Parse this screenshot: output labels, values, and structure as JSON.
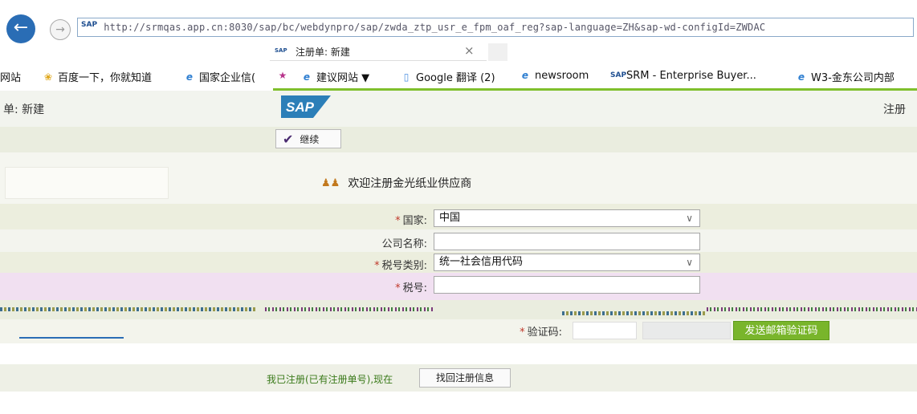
{
  "browser": {
    "url": "http://srmqas.app.cn:8030/sap/bc/webdynpro/sap/zwda_ztp_usr_e_fpm_oaf_reg?sap-language=ZH&sap-wd-configId=ZWDAC",
    "tab_title": "注册单: 新建",
    "tab_close": "×",
    "tab_icon_text": "SAP",
    "url_icon_text": "SAP"
  },
  "favorites": [
    {
      "label": "网站",
      "icon": ""
    },
    {
      "label": "百度一下，你就知道",
      "icon": "paw-icon"
    },
    {
      "label": "国家企业信(",
      "icon": "ie-icon"
    },
    {
      "label": "",
      "icon": "star-folder-icon"
    },
    {
      "label": "建议网站 ▼",
      "icon": "ie-icon"
    },
    {
      "label": "Google 翻译 (2)",
      "icon": "translate-icon"
    },
    {
      "label": "newsroom",
      "icon": "ie-icon"
    },
    {
      "label": "SRM - Enterprise Buyer...",
      "icon": "sap-icon"
    },
    {
      "label": "W3-金东公司内部",
      "icon": "ie-icon"
    }
  ],
  "header": {
    "title": "单: 新建",
    "logo_text": "SAP",
    "right_text": "注册"
  },
  "toolbar": {
    "continue_label": "继续"
  },
  "welcome": {
    "text": "欢迎注册金光纸业供应商"
  },
  "form": {
    "country_label": "国家:",
    "country_value": "中国",
    "company_label": "公司名称:",
    "company_value": "",
    "tax_type_label": "税号类别:",
    "tax_type_value": "统一社会信用代码",
    "tax_no_label": "税号:",
    "tax_no_value": "",
    "required_mark": "*",
    "captcha_label": "验证码:",
    "send_code_label": "发送邮箱验证码"
  },
  "retrieve": {
    "text": "我已注册(已有注册单号),现在",
    "button_label": "找回注册信息"
  },
  "colors": {
    "accent_green": "#7fbf2c",
    "sap_blue": "#1f4f91",
    "back_blue": "#2a6db5"
  }
}
